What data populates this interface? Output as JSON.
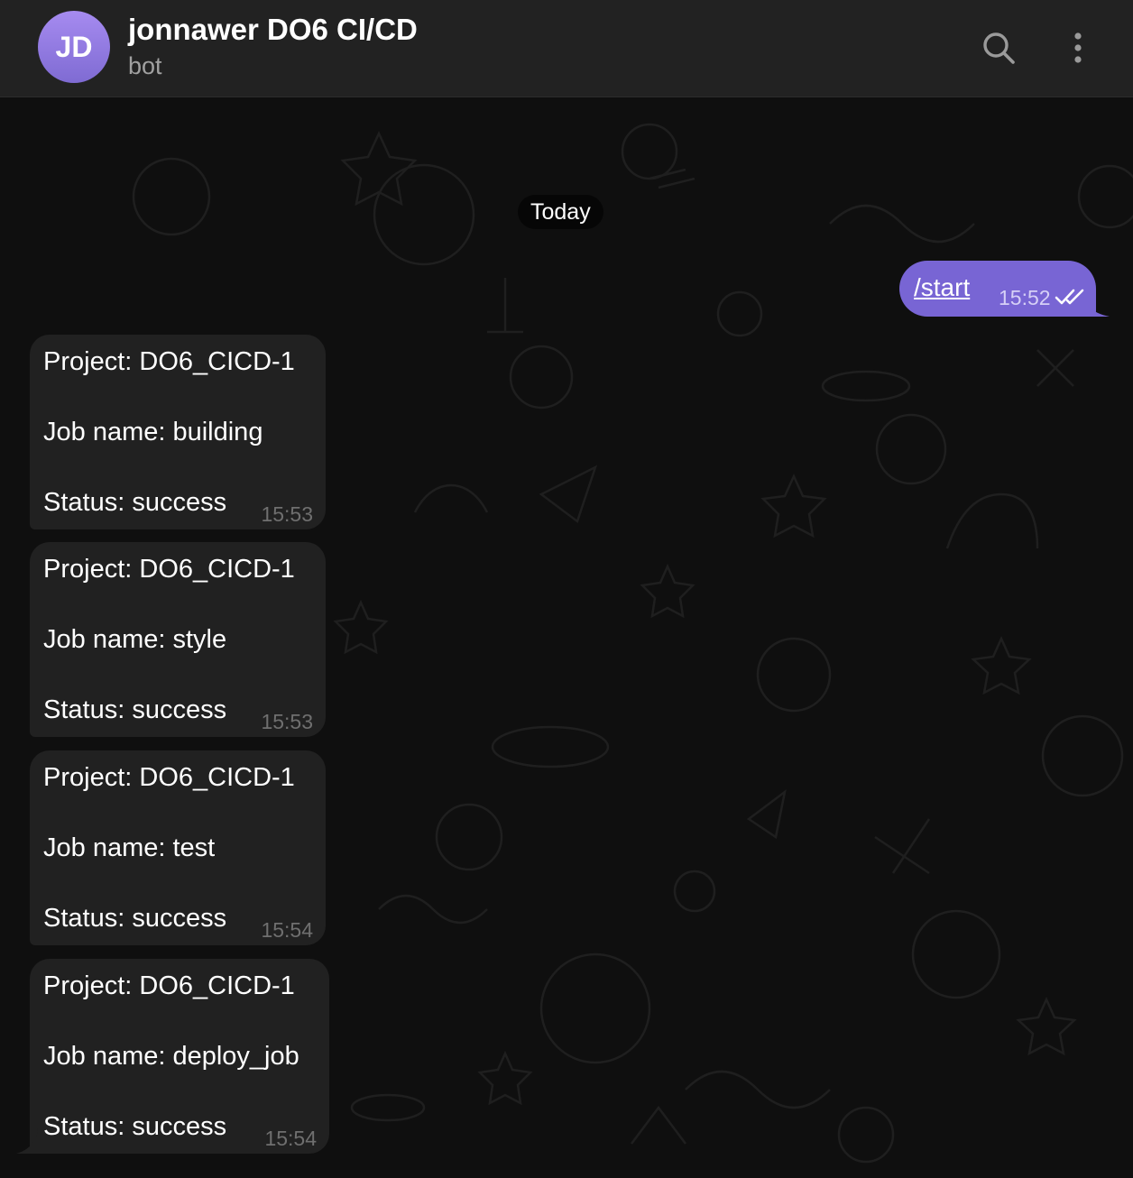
{
  "header": {
    "avatar_initials": "JD",
    "title": "jonnawer DO6 CI/CD",
    "subtitle": "bot",
    "search_icon": "search-icon",
    "menu_icon": "more-vertical-icon"
  },
  "chat": {
    "date_label": "Today",
    "outgoing": {
      "text": "/start",
      "time": "15:52",
      "status_icon": "double-check-icon"
    },
    "messages": [
      {
        "project": "Project: DO6_CICD-1",
        "job": "Job name: building",
        "status": "Status: success",
        "time": "15:53"
      },
      {
        "project": "Project: DO6_CICD-1",
        "job": "Job name: style",
        "status": "Status: success",
        "time": "15:53"
      },
      {
        "project": "Project: DO6_CICD-1",
        "job": "Job name: test",
        "status": "Status: success",
        "time": "15:54"
      },
      {
        "project": "Project: DO6_CICD-1",
        "job": "Job name: deploy_job",
        "status": "Status: success",
        "time": "15:54"
      }
    ]
  },
  "colors": {
    "header_bg": "#222222",
    "chat_bg": "#0f0f0f",
    "outgoing_bubble": "#7865d4",
    "incoming_bubble": "#212121",
    "avatar_gradient_top": "#a68bf0",
    "avatar_gradient_bottom": "#7f6bd3"
  }
}
